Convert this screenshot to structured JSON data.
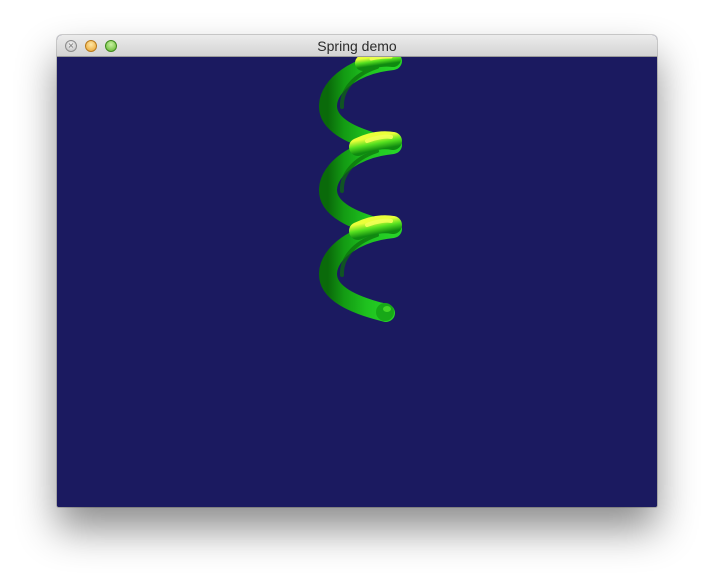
{
  "window": {
    "title": "Spring demo"
  },
  "titlebar": {
    "buttons": [
      {
        "name": "close",
        "icon": "close-icon",
        "color": "#c6c6c6"
      },
      {
        "name": "minimize",
        "icon": "minimize-icon",
        "color": "#f0b33a"
      },
      {
        "name": "maximize",
        "icon": "maximize-icon",
        "color": "#6fc13a"
      }
    ]
  },
  "scene": {
    "background_color": "#1b1a60",
    "spring_color": "#1fc21f",
    "spring_highlight": "#eaff3a",
    "spring_shadow": "#0a6a0a"
  }
}
